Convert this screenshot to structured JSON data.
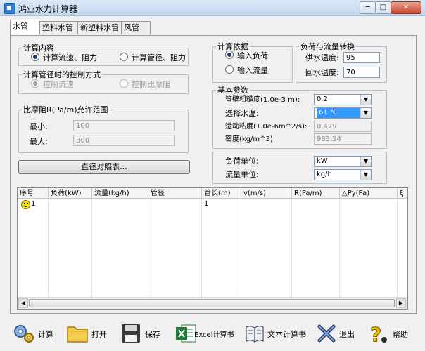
{
  "window": {
    "title": "鸿业水力计算器",
    "minimize": "─",
    "maximize": "□",
    "close": "✕"
  },
  "tabs": [
    {
      "label": "水管",
      "active": true
    },
    {
      "label": "塑料水管",
      "active": false
    },
    {
      "label": "新塑料水管",
      "active": false
    },
    {
      "label": "风管",
      "active": false
    }
  ],
  "calc_content": {
    "title": "计算内容",
    "options": [
      {
        "label": "计算流速、阻力",
        "checked": true
      },
      {
        "label": "计算管径、阻力",
        "checked": false
      }
    ]
  },
  "control_mode": {
    "title": "计算管径时的控制方式",
    "options": [
      {
        "label": "控制流速",
        "checked": true
      },
      {
        "label": "控制比摩阻",
        "checked": false
      }
    ]
  },
  "friction_range": {
    "title": "比摩阻R(Pa/m)允许范围",
    "min_label": "最小:",
    "min_value": "100",
    "max_label": "最大:",
    "max_value": "300"
  },
  "diameter_button": "直径对照表...",
  "calc_basis": {
    "title": "计算依据",
    "options": [
      {
        "label": "输入负荷",
        "checked": true
      },
      {
        "label": "输入流量",
        "checked": false
      }
    ]
  },
  "load_conversion": {
    "title": "负荷与流量转换",
    "supply_label": "供水温度:",
    "supply_value": "95",
    "return_label": "回水温度:",
    "return_value": "70"
  },
  "basic_params": {
    "title": "基本参数",
    "roughness_label": "管壁粗糙度(1.0e-3 m):",
    "roughness_value": "0.2",
    "water_temp_label": "选择水温:",
    "water_temp_value": "61 ℃",
    "viscosity_label": "运动粘度(1.0e-6m^2/s):",
    "viscosity_value": "0.479",
    "density_label": "密度(kg/m^3):",
    "density_value": "983.24"
  },
  "units": {
    "load_label": "负荷单位:",
    "load_value": "kW",
    "flow_label": "流量单位:",
    "flow_value": "kg/h"
  },
  "table": {
    "columns": [
      "序号",
      "负荷(kW)",
      "流量(kg/h)",
      "管径",
      "管长(m)",
      "v(m/s)",
      "R(Pa/m)",
      "△Py(Pa)",
      "ξ"
    ],
    "rows": [
      {
        "index": "1",
        "load": "",
        "flow": "",
        "diameter": "",
        "length": "1",
        "v": "",
        "r": "",
        "py": "",
        "xi": ""
      }
    ]
  },
  "toolbar": [
    {
      "label": "计算",
      "icon": "gears-icon"
    },
    {
      "label": "打开",
      "icon": "folder-icon"
    },
    {
      "label": "保存",
      "icon": "floppy-icon"
    },
    {
      "label": "Excel计算书",
      "icon": "excel-icon"
    },
    {
      "label": "文本计算书",
      "icon": "book-icon"
    },
    {
      "label": "退出",
      "icon": "exit-icon"
    },
    {
      "label": "帮助",
      "icon": "help-icon"
    }
  ],
  "colors": {
    "selection": "#3399ff",
    "title_bar": "#c4d7ee",
    "excel_green": "#1f7a3a"
  }
}
